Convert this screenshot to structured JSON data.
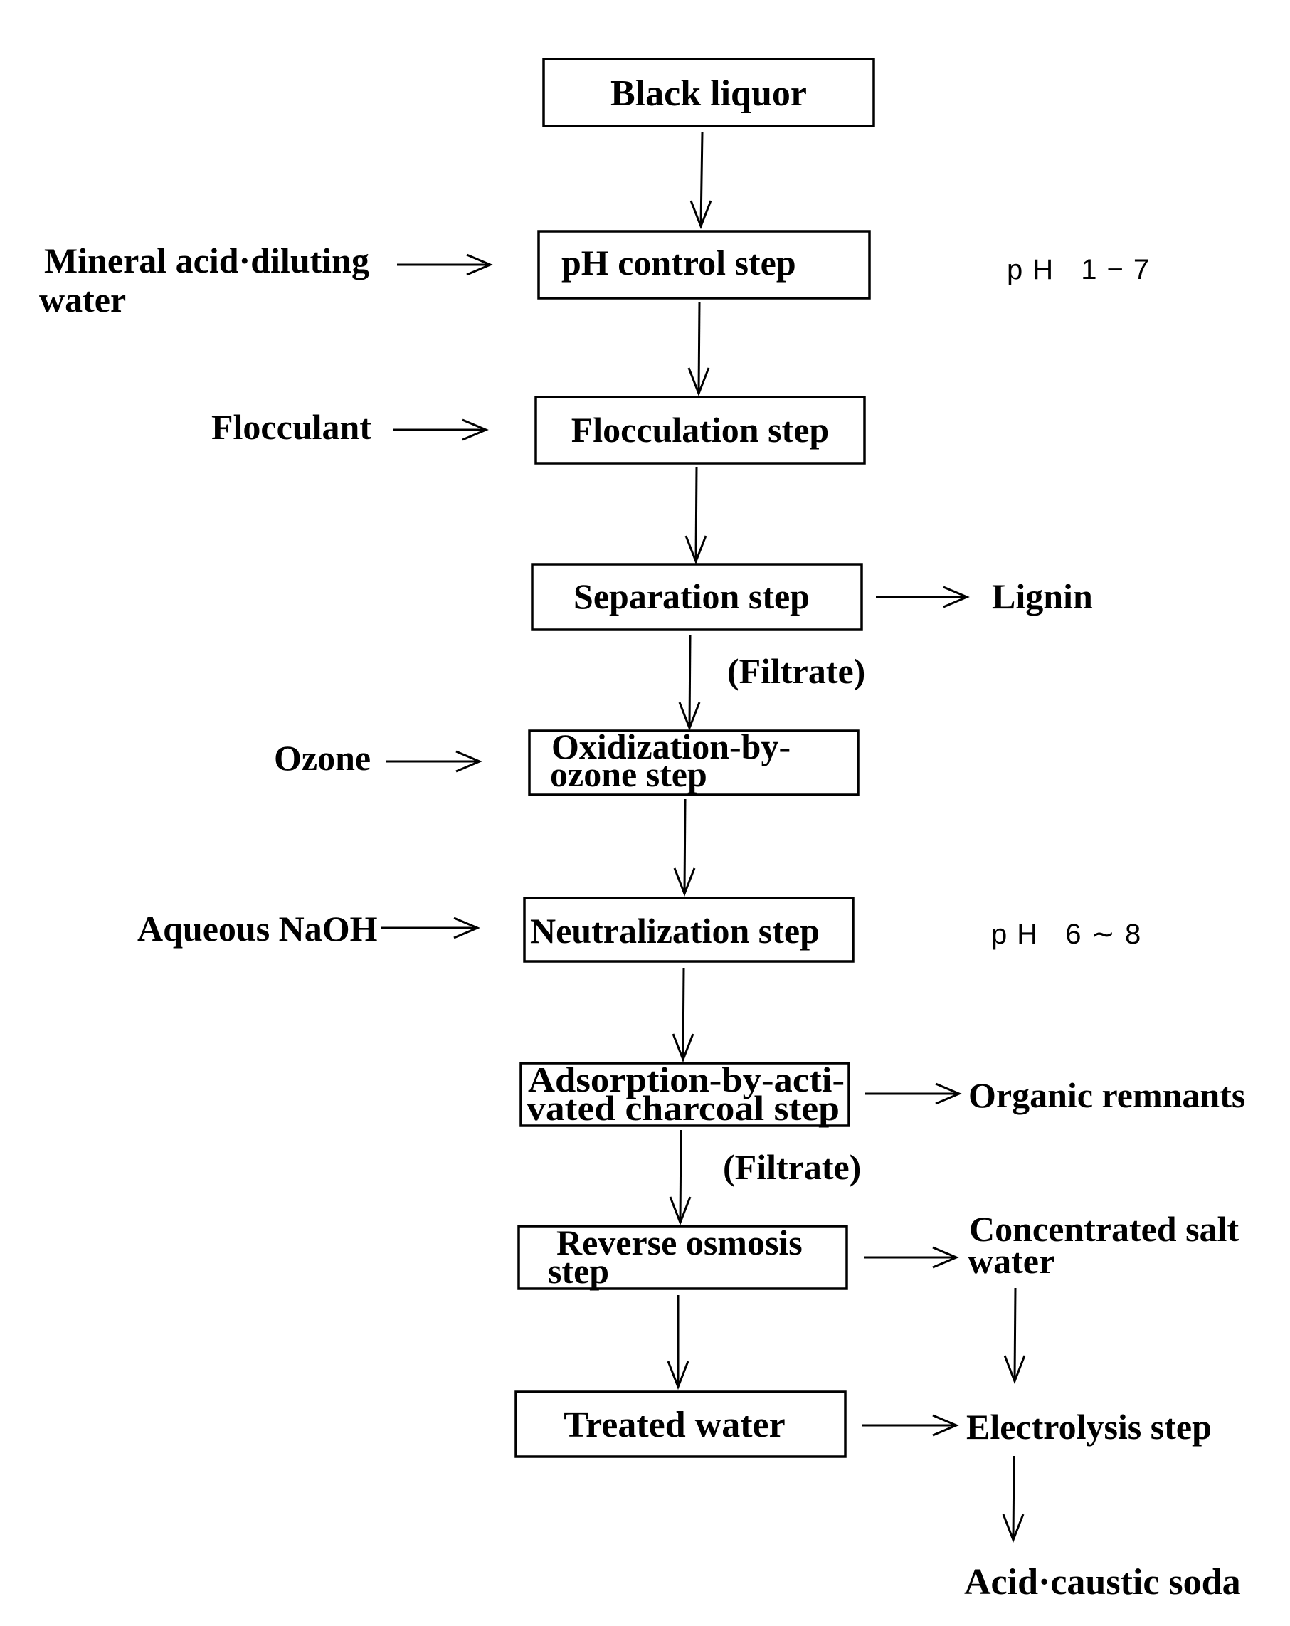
{
  "diagram": {
    "type": "process-flowchart",
    "steps": {
      "black_liquor": "Black liquor",
      "ph_control": "pH control step",
      "flocculation": "Flocculation step",
      "separation": "Separation step",
      "oxidization_line1": "Oxidization-by-",
      "oxidization_line2": "ozone step",
      "neutralization": "Neutralization step",
      "adsorption_line1": "Adsorption-by-acti-",
      "adsorption_line2": "vated charcoal step",
      "reverse_osmosis_line1": "Reverse osmosis",
      "reverse_osmosis_line2": "step",
      "treated_water": "Treated water"
    },
    "inputs": {
      "mineral_acid_line1": "Mineral acid·diluting",
      "mineral_acid_line2": "water",
      "flocculant": "Flocculant",
      "ozone": "Ozone",
      "naoh": "Aqueous NaOH"
    },
    "outputs": {
      "lignin": "Lignin",
      "organic_remnants": "Organic remnants",
      "salt_water_line1": "Concentrated salt",
      "salt_water_line2": "water",
      "electrolysis": "Electrolysis step",
      "acid_caustic": "Acid·caustic soda"
    },
    "annotations": {
      "ph_range_1": "pH 1−7",
      "ph_range_2": "pH 6∼8",
      "filtrate_1": "(Filtrate)",
      "filtrate_2": "(Filtrate)"
    }
  }
}
